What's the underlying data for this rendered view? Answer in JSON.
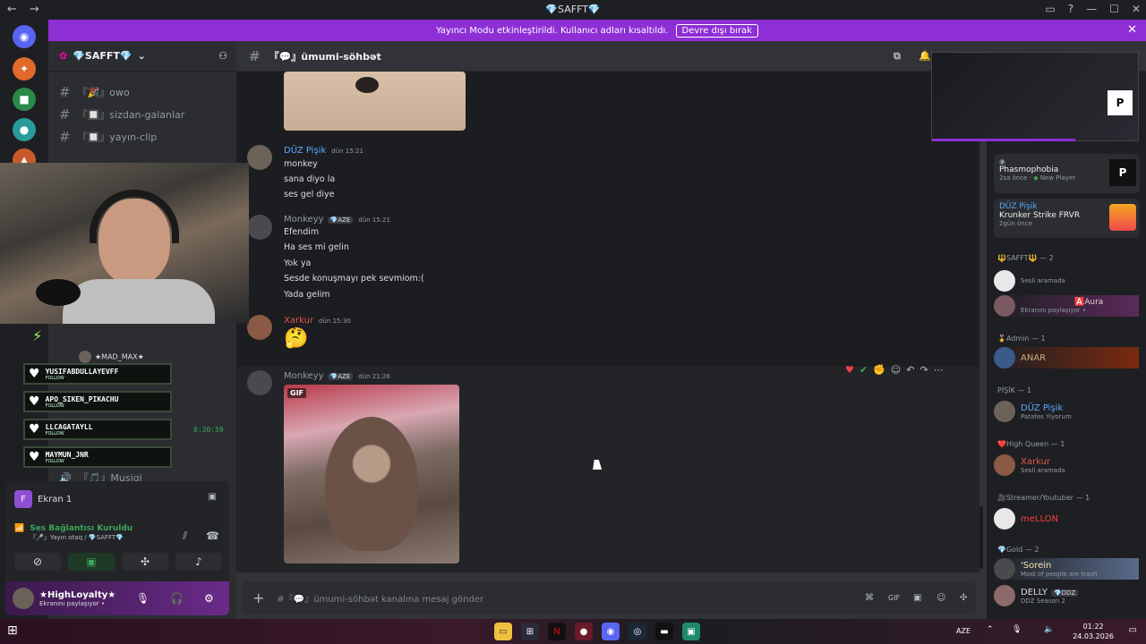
{
  "window": {
    "title": "💎SAFFT💎",
    "nav_back": "←",
    "nav_forward": "→",
    "minimize": "—",
    "maximize": "☐",
    "close": "✕"
  },
  "banner": {
    "text": "Yayıncı Modu etkinleştirildi. Kullanıcı adları kısaltıldı.",
    "button": "Devre dışı bırak",
    "close": "✕"
  },
  "server": {
    "name": "💎SAFFT💎",
    "channels": [
      {
        "name": "『🎉』owo"
      },
      {
        "name": "『🔲』sizdan-galanlar"
      },
      {
        "name": "『🔲』yayın-clip"
      }
    ],
    "extra_channel": "『🎵』Musiqi",
    "timer": "8:30:59"
  },
  "chat": {
    "channel_name": "『💬』ümumi-söhbət",
    "messages": [
      {
        "user": "DÜZ Pişik",
        "color": "#5aa9ff",
        "time": "dün 15:21",
        "lines": [
          "monkey",
          "sana diyo la",
          "ses gel diye"
        ]
      },
      {
        "user": "Monkeyy",
        "color": "#949ba4",
        "tag": "💎AZE",
        "time": "dün 15:21",
        "lines": [
          "Efendim",
          "Ha ses mi gelin",
          "Yok ya",
          "Sesde konuşmayı pek sevmiom:(",
          "Yada gelim"
        ]
      },
      {
        "user": "Xarkur",
        "color": "#e0584f",
        "time": "dün 15:30",
        "lines": [
          "🤔"
        ]
      },
      {
        "user": "Monkeyy",
        "color": "#949ba4",
        "tag": "💎AZE",
        "time": "dün 21:26",
        "lines": [],
        "gif_label": "GIF"
      }
    ],
    "input_placeholder": "#『💬』ümumi-söhbət kanalına mesaj gönder"
  },
  "activity": [
    {
      "game": "Phasmophobia",
      "meta": "2sa önce",
      "meta2": "New Player"
    },
    {
      "user": "DÜZ Pişik",
      "game": "Krunker Strike FRVR",
      "meta": "2gün önce"
    }
  ],
  "members": {
    "groups": [
      {
        "title": "🔱SAFFT🔱 — 2",
        "items": [
          {
            "name": "",
            "sub": "Sesli aramada",
            "color": "#dbdee1"
          },
          {
            "name": "🅰️Aura",
            "sub": "Ekranını paylaşıyor •",
            "color": "#f2c6d6"
          }
        ]
      },
      {
        "title": "🎖️Admin — 1",
        "items": [
          {
            "name": "ANAR",
            "sub": "",
            "color": "#c7ad7a"
          }
        ]
      },
      {
        "title": "PİŞİK — 1",
        "items": [
          {
            "name": "DÜZ Pişik",
            "sub": "Patates Yiyorum",
            "color": "#5aa9ff"
          }
        ]
      },
      {
        "title": "❤️High Queen — 1",
        "items": [
          {
            "name": "Xarkur",
            "sub": "Sesli aramada",
            "color": "#e0584f"
          }
        ]
      },
      {
        "title": "🎥Streamer/Youtuber — 1",
        "items": [
          {
            "name": "meLLON",
            "sub": "",
            "color": "#ff3b3b"
          }
        ]
      },
      {
        "title": "💎Gold — 2",
        "items": [
          {
            "name": "'Sorein",
            "sub": "Most of people are trash",
            "color": "#f2e2b2"
          },
          {
            "name": "DELLY",
            "tag": "💎DDZ",
            "sub": "DDZ Season 2",
            "color": "#f2f3f5"
          }
        ]
      }
    ]
  },
  "overlay": {
    "alerts": [
      {
        "name": "YUSIFABDULLAYEVFF",
        "action": "FOLLOW"
      },
      {
        "name": "APO_SIKEN_PIKACHU",
        "action": "FOLLOW"
      },
      {
        "name": "LLCAGATAYLL",
        "action": "FOLLOW"
      },
      {
        "name": "MAYMUN_JNR",
        "action": "FOLLOW"
      }
    ],
    "overlay_user": "★MAD_MAX★"
  },
  "user_panel": {
    "screen_label": "Ekran 1",
    "voice_status": "Ses Bağlantısı Kuruldu",
    "voice_channel": "『🎤』Yayın otaq / 💎SAFFT💎",
    "username": "★HighLoyalty★",
    "user_status": "Ekranını paylaşıyor •",
    "avatar_letter": "F"
  },
  "taskbar": {
    "lang": "AZE",
    "time": "01:22",
    "date": "24.03.2026"
  },
  "colors": {
    "accent": "#8e2fd6",
    "background": "#313338"
  }
}
